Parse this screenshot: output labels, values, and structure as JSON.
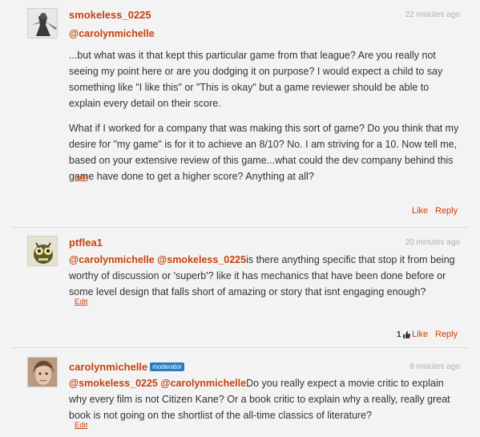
{
  "comments": [
    {
      "username": "smokeless_0225",
      "timestamp": "22 minutes ago",
      "reply_to": "@carolynmichelle",
      "paragraphs": [
        "...but what was it that kept this particular game from that league? Are you really not seeing my point here or are you dodging it on purpose? I would expect a child to say something like \"I like this\" or \"This is okay\" but a game reviewer should be able to explain every detail on their score.",
        "What if I worked for a company that was making this sort of game? Do you think that my desire for \"my game\" is for it to achieve an 8/10? No. I am striving for a 10. Now tell me, based on your extensive review of this game...what could the dev company behind this game have done to get a higher score? Anything at all?"
      ],
      "edit": "Edit",
      "like": "Like",
      "reply": "Reply"
    },
    {
      "username": "ptflea1",
      "timestamp": "20 minutes ago",
      "mentions": [
        "@carolynmichelle",
        "@smokeless_0225"
      ],
      "text": "is there anything specific that stop it from being worthy of discussion or 'superb'? like it has mechanics that have been done before or some level design that falls short of amazing or story that isnt engaging enough?",
      "edit": "Edit",
      "like_count": "1",
      "like": "Like",
      "reply": "Reply"
    },
    {
      "username": "carolynmichelle",
      "badge": "moderator",
      "timestamp": "8 minutes ago",
      "mentions": [
        "@smokeless_0225",
        "@carolynmichelle"
      ],
      "text": "Do you really expect a movie critic to explain why every film is not Citizen Kane? Or a book critic to explain why a really, really great book is not going on the shortlist of the all-time classics of literature?",
      "edit": "Edit"
    }
  ],
  "colors": {
    "accent": "#c8410e",
    "badge": "#2a7cc0",
    "background": "#f3f3f3"
  }
}
